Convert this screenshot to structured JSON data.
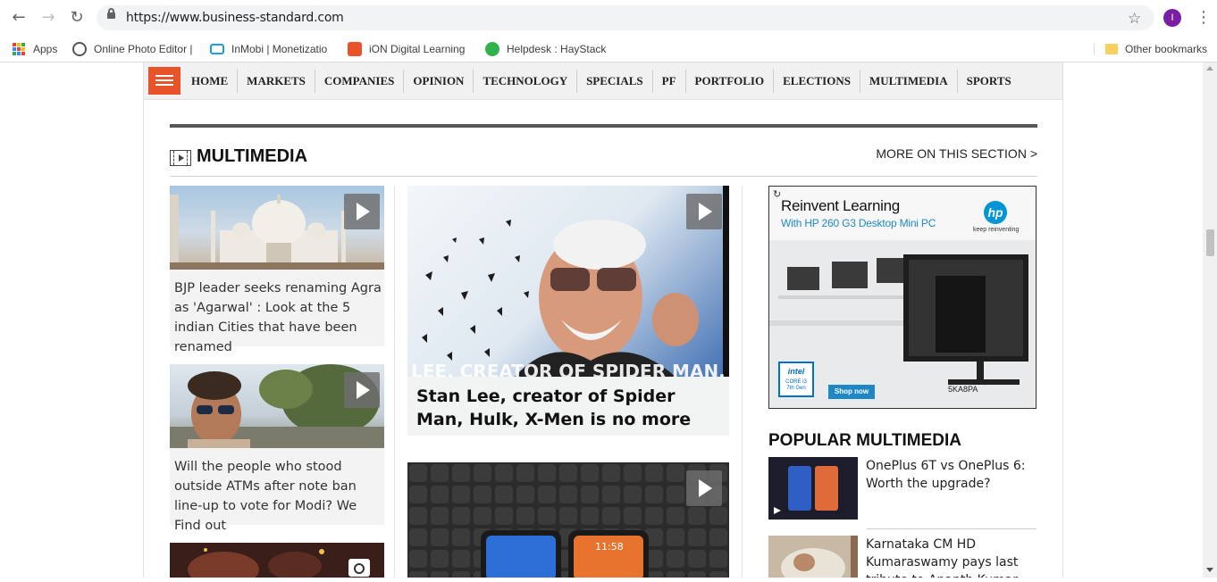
{
  "browser": {
    "url": "https://www.business-standard.com",
    "profile_initial": "I",
    "bookmarks": [
      {
        "label": "Apps",
        "icon": "apps-grid-icon"
      },
      {
        "label": "Online Photo Editor |",
        "icon": "photo-editor-icon"
      },
      {
        "label": "InMobi | Monetizatio",
        "icon": "inmobi-icon"
      },
      {
        "label": "iON Digital Learning",
        "icon": "ion-icon"
      },
      {
        "label": "Helpdesk : HayStack",
        "icon": "haystack-icon"
      }
    ],
    "other_bookmarks": "Other bookmarks"
  },
  "navbar": {
    "items": [
      "HOME",
      "MARKETS",
      "COMPANIES",
      "OPINION",
      "TECHNOLOGY",
      "SPECIALS",
      "PF",
      "PORTFOLIO",
      "ELECTIONS",
      "MULTIMEDIA",
      "SPORTS"
    ]
  },
  "section": {
    "title": "MULTIMEDIA",
    "more_link": "MORE ON THIS SECTION >"
  },
  "left_cards": [
    {
      "text": "BJP leader seeks renaming Agra as 'Agarwal' : Look at the 5 indian Cities that have been renamed"
    },
    {
      "text": "Will the people who stood outside ATMs after note ban line-up to vote for Modi? We Find out"
    }
  ],
  "featured": {
    "caption": "Stan Lee, creator of Spider Man, Hulk, X-Men is no more",
    "overlay_text": "LEE, CREATOR OF SPIDER MAN,"
  },
  "ad": {
    "title": "Reinvent Learning",
    "subtitle": "With HP 260 G3 Desktop Mini PC",
    "tagline": "keep reinventing",
    "hp": "hp",
    "shop": "Shop now",
    "model": "5KA8PA",
    "intel_brand": "intel",
    "intel_line1": "CORE i3",
    "intel_line2": "7th Gen"
  },
  "popular": {
    "title": "POPULAR MULTIMEDIA",
    "items": [
      {
        "text": "OnePlus 6T vs OnePlus 6: Worth the upgrade?"
      },
      {
        "text": "Karnataka CM HD Kumaraswamy pays last tribute to Ananth Kumar"
      }
    ]
  },
  "colors": {
    "accent": "#e8532a",
    "hp_blue": "#0096d6",
    "profile": "#7b1fa2"
  }
}
